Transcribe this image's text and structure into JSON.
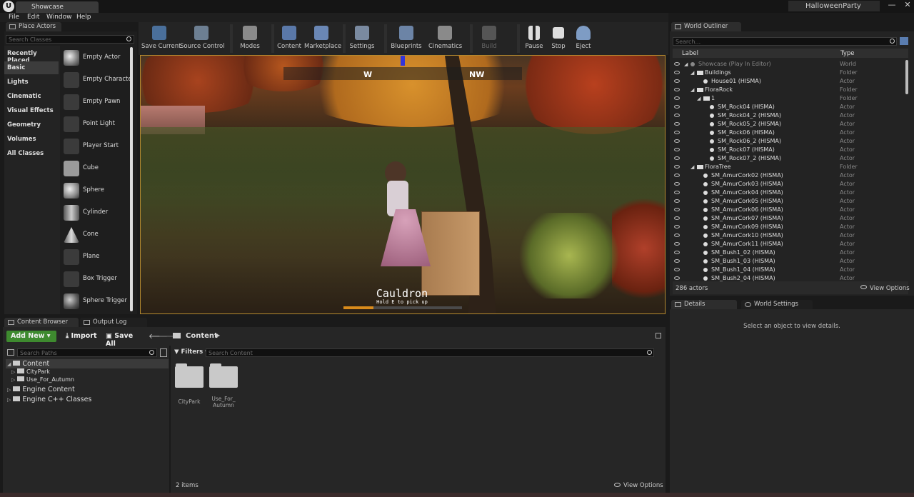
{
  "window": {
    "tab_title": "Showcase",
    "project_name": "HalloweenParty"
  },
  "menu": [
    "File",
    "Edit",
    "Window",
    "Help"
  ],
  "place_actors": {
    "tab_title": "Place Actors",
    "search_placeholder": "Search Classes",
    "categories": [
      "Recently Placed",
      "Basic",
      "Lights",
      "Cinematic",
      "Visual Effects",
      "Geometry",
      "Volumes",
      "All Classes"
    ],
    "actors": [
      "Empty Actor",
      "Empty Characte",
      "Empty Pawn",
      "Point Light",
      "Player Start",
      "Cube",
      "Sphere",
      "Cylinder",
      "Cone",
      "Plane",
      "Box Trigger",
      "Sphere Trigger"
    ]
  },
  "toolbar": [
    "Save Current",
    "Source Control",
    "Modes",
    "Content",
    "Marketplace",
    "Settings",
    "Blueprints",
    "Cinematics",
    "Build",
    "Pause",
    "Stop",
    "Eject"
  ],
  "viewport": {
    "compass_w": "W",
    "compass_nw": "NW",
    "interact_title": "Cauldron",
    "interact_hint": "Hold E to pick up",
    "progress": 0.25
  },
  "outliner": {
    "tab_title": "World Outliner",
    "search_placeholder": "Search...",
    "col_label": "Label",
    "col_type": "Type",
    "rows": [
      {
        "label": "Showcase (Play In Editor)",
        "type": "World",
        "depth": 0,
        "kind": "world",
        "dim": true
      },
      {
        "label": "Buildings",
        "type": "Folder",
        "depth": 1,
        "kind": "folder"
      },
      {
        "label": "House01 (HISMA)",
        "type": "Actor",
        "depth": 2,
        "kind": "actor"
      },
      {
        "label": "FloraRock",
        "type": "Folder",
        "depth": 1,
        "kind": "folder"
      },
      {
        "label": "1",
        "type": "Folder",
        "depth": 2,
        "kind": "folder"
      },
      {
        "label": "SM_Rock04 (HISMA)",
        "type": "Actor",
        "depth": 3,
        "kind": "actor"
      },
      {
        "label": "SM_Rock04_2 (HISMA)",
        "type": "Actor",
        "depth": 3,
        "kind": "actor"
      },
      {
        "label": "SM_Rock05_2 (HISMA)",
        "type": "Actor",
        "depth": 3,
        "kind": "actor"
      },
      {
        "label": "SM_Rock06 (HISMA)",
        "type": "Actor",
        "depth": 3,
        "kind": "actor"
      },
      {
        "label": "SM_Rock06_2 (HISMA)",
        "type": "Actor",
        "depth": 3,
        "kind": "actor"
      },
      {
        "label": "SM_Rock07 (HISMA)",
        "type": "Actor",
        "depth": 3,
        "kind": "actor"
      },
      {
        "label": "SM_Rock07_2 (HISMA)",
        "type": "Actor",
        "depth": 3,
        "kind": "actor"
      },
      {
        "label": "FloraTree",
        "type": "Folder",
        "depth": 1,
        "kind": "folder"
      },
      {
        "label": "SM_AmurCork02 (HISMA)",
        "type": "Actor",
        "depth": 2,
        "kind": "actor"
      },
      {
        "label": "SM_AmurCork03 (HISMA)",
        "type": "Actor",
        "depth": 2,
        "kind": "actor"
      },
      {
        "label": "SM_AmurCork04 (HISMA)",
        "type": "Actor",
        "depth": 2,
        "kind": "actor"
      },
      {
        "label": "SM_AmurCork05 (HISMA)",
        "type": "Actor",
        "depth": 2,
        "kind": "actor"
      },
      {
        "label": "SM_AmurCork06 (HISMA)",
        "type": "Actor",
        "depth": 2,
        "kind": "actor"
      },
      {
        "label": "SM_AmurCork07 (HISMA)",
        "type": "Actor",
        "depth": 2,
        "kind": "actor"
      },
      {
        "label": "SM_AmurCork09 (HISMA)",
        "type": "Actor",
        "depth": 2,
        "kind": "actor"
      },
      {
        "label": "SM_AmurCork10 (HISMA)",
        "type": "Actor",
        "depth": 2,
        "kind": "actor"
      },
      {
        "label": "SM_AmurCork11 (HISMA)",
        "type": "Actor",
        "depth": 2,
        "kind": "actor"
      },
      {
        "label": "SM_Bush1_02 (HISMA)",
        "type": "Actor",
        "depth": 2,
        "kind": "actor"
      },
      {
        "label": "SM_Bush1_03 (HISMA)",
        "type": "Actor",
        "depth": 2,
        "kind": "actor"
      },
      {
        "label": "SM_Bush1_04 (HISMA)",
        "type": "Actor",
        "depth": 2,
        "kind": "actor"
      },
      {
        "label": "SM_Bush2_04 (HISMA)",
        "type": "Actor",
        "depth": 2,
        "kind": "actor"
      }
    ],
    "actor_count": "286 actors",
    "view_options": "View Options"
  },
  "details": {
    "tab_details": "Details",
    "tab_world_settings": "World Settings",
    "empty_message": "Select an object to view details."
  },
  "content_browser": {
    "tab_title": "Content Browser",
    "tab_output_log": "Output Log",
    "add_new": "Add New",
    "import": "Import",
    "save_all": "Save All",
    "path": "Content",
    "search_paths_placeholder": "Search Paths",
    "filters": "Filters",
    "search_content_placeholder": "Search Content",
    "tree": [
      {
        "label": "Content",
        "depth": 0
      },
      {
        "label": "CityPark",
        "depth": 1
      },
      {
        "label": "Use_For_Autumn",
        "depth": 1
      },
      {
        "label": "Engine Content",
        "depth": 0
      },
      {
        "label": "Engine C++ Classes",
        "depth": 0
      }
    ],
    "folders": [
      "CityPark",
      "Use_For_\nAutumn"
    ],
    "item_count": "2 items",
    "view_options": "View Options"
  }
}
